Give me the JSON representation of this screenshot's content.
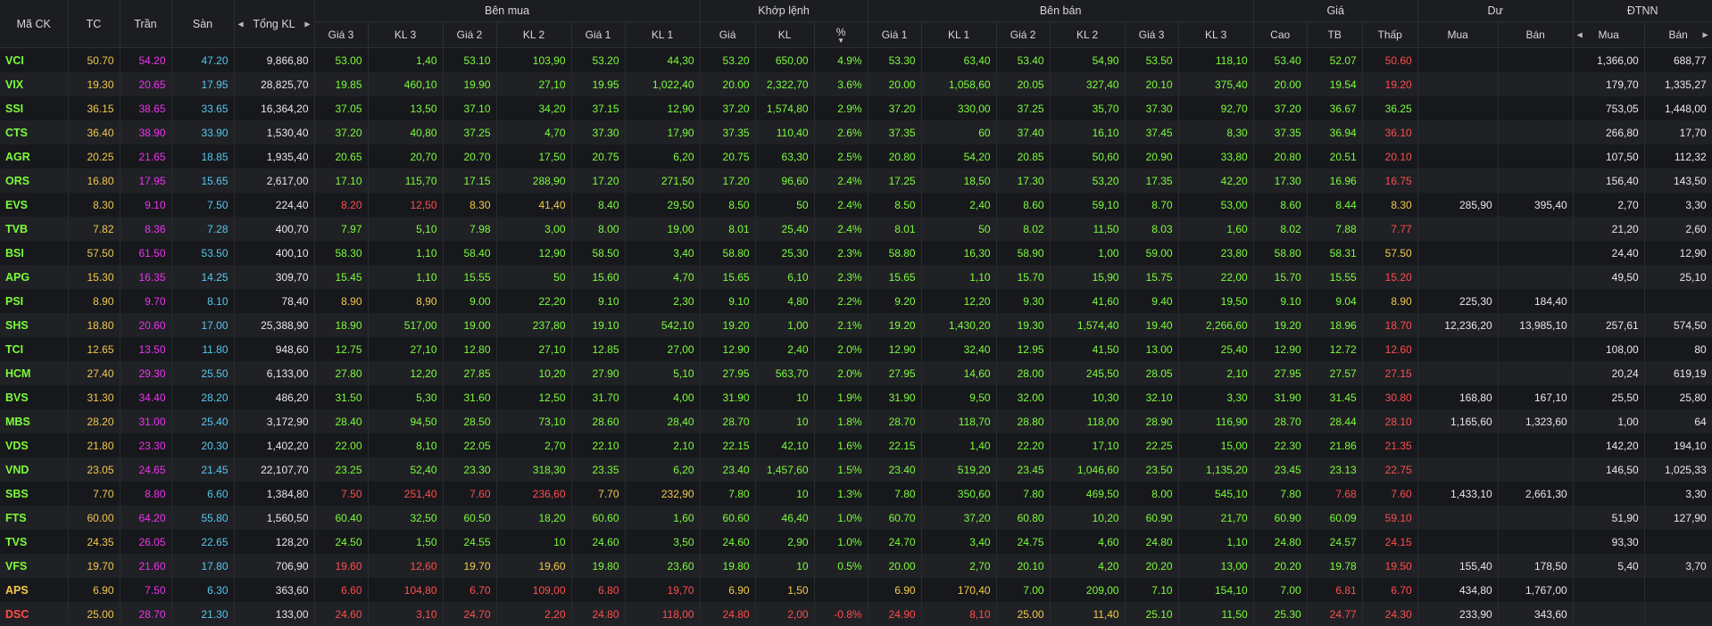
{
  "headers": {
    "symbol": "Mã CK",
    "ref": "TC",
    "ceil": "Trần",
    "floor": "Sàn",
    "total_vol": "Tổng KL",
    "bid_group": "Bên mua",
    "match_group": "Khớp lệnh",
    "ask_group": "Bên bán",
    "price_group": "Giá",
    "rest_group": "Dư",
    "foreign_group": "ĐTNN",
    "bid_price3": "Giá 3",
    "bid_vol3": "KL 3",
    "bid_price2": "Giá 2",
    "bid_vol2": "KL 2",
    "bid_price1": "Giá 1",
    "bid_vol1": "KL 1",
    "match_price": "Giá",
    "match_vol": "KL",
    "match_pct": "%",
    "ask_price1": "Giá 1",
    "ask_vol1": "KL 1",
    "ask_price2": "Giá 2",
    "ask_vol2": "KL 2",
    "ask_price3": "Giá 3",
    "ask_vol3": "KL 3",
    "high": "Cao",
    "avg": "TB",
    "low": "Thấp",
    "rest_buy": "Mua",
    "rest_sell": "Bán",
    "foreign_buy": "Mua",
    "foreign_sell": "Bán"
  },
  "colors": {
    "up": "#7cfc3c",
    "ref": "#f2c94c",
    "down": "#ff4d4d",
    "ceil": "#ee33ee",
    "floor": "#55c8f0",
    "neutral": "#e8e8e8"
  },
  "rows": [
    {
      "sym": "VCI",
      "symc": "g",
      "tc": "50.70",
      "tran": "54.20",
      "san": "47.20",
      "tkl": "9,866,80",
      "bp3": "53.00",
      "bv3": "1,40",
      "bp2": "53.10",
      "bv2": "103,90",
      "bp1": "53.20",
      "bv1": "44,30",
      "bc": "g",
      "mp": "53.20",
      "mv": "650,00",
      "pct": "4.9%",
      "mc": "g",
      "ap1": "53.30",
      "av1": "63,40",
      "ap2": "53.40",
      "av2": "54,90",
      "ap3": "53.50",
      "av3": "118,10",
      "ac": "g",
      "hi": "53.40",
      "hic": "g",
      "avg": "52.07",
      "avgc": "g",
      "lo": "50.60",
      "loc": "r",
      "rb": "",
      "rs": "",
      "fb": "1,366,00",
      "fs": "688,77"
    },
    {
      "sym": "VIX",
      "symc": "g",
      "tc": "19.30",
      "tran": "20.65",
      "san": "17.95",
      "tkl": "28,825,70",
      "bp3": "19.85",
      "bv3": "460,10",
      "bp2": "19.90",
      "bv2": "27,10",
      "bp1": "19.95",
      "bv1": "1,022,40",
      "bc": "g",
      "mp": "20.00",
      "mv": "2,322,70",
      "pct": "3.6%",
      "mc": "g",
      "ap1": "20.00",
      "av1": "1,058,60",
      "ap2": "20.05",
      "av2": "327,40",
      "ap3": "20.10",
      "av3": "375,40",
      "ac": "g",
      "hi": "20.00",
      "hic": "g",
      "avg": "19.54",
      "avgc": "g",
      "lo": "19.20",
      "loc": "r",
      "rb": "",
      "rs": "",
      "fb": "179,70",
      "fs": "1,335,27"
    },
    {
      "sym": "SSI",
      "symc": "g",
      "tc": "36.15",
      "tran": "38.65",
      "san": "33.65",
      "tkl": "16,364,20",
      "bp3": "37.05",
      "bv3": "13,50",
      "bp2": "37.10",
      "bv2": "34,20",
      "bp1": "37.15",
      "bv1": "12,90",
      "bc": "g",
      "mp": "37.20",
      "mv": "1,574,80",
      "pct": "2.9%",
      "mc": "g",
      "ap1": "37.20",
      "av1": "330,00",
      "ap2": "37.25",
      "av2": "35,70",
      "ap3": "37.30",
      "av3": "92,70",
      "ac": "g",
      "hi": "37.20",
      "hic": "g",
      "avg": "36.67",
      "avgc": "g",
      "lo": "36.25",
      "loc": "g",
      "rb": "",
      "rs": "",
      "fb": "753,05",
      "fs": "1,448,00"
    },
    {
      "sym": "CTS",
      "symc": "g",
      "tc": "36.40",
      "tran": "38.90",
      "san": "33.90",
      "tkl": "1,530,40",
      "bp3": "37.20",
      "bv3": "40,80",
      "bp2": "37.25",
      "bv2": "4,70",
      "bp1": "37.30",
      "bv1": "17,90",
      "bc": "g",
      "mp": "37.35",
      "mv": "110,40",
      "pct": "2.6%",
      "mc": "g",
      "ap1": "37.35",
      "av1": "60",
      "ap2": "37.40",
      "av2": "16,10",
      "ap3": "37.45",
      "av3": "8,30",
      "ac": "g",
      "hi": "37.35",
      "hic": "g",
      "avg": "36.94",
      "avgc": "g",
      "lo": "36.10",
      "loc": "r",
      "rb": "",
      "rs": "",
      "fb": "266,80",
      "fs": "17,70"
    },
    {
      "sym": "AGR",
      "symc": "g",
      "tc": "20.25",
      "tran": "21.65",
      "san": "18.85",
      "tkl": "1,935,40",
      "bp3": "20.65",
      "bv3": "20,70",
      "bp2": "20.70",
      "bv2": "17,50",
      "bp1": "20.75",
      "bv1": "6,20",
      "bc": "g",
      "mp": "20.75",
      "mv": "63,30",
      "pct": "2.5%",
      "mc": "g",
      "ap1": "20.80",
      "av1": "54,20",
      "ap2": "20.85",
      "av2": "50,60",
      "ap3": "20.90",
      "av3": "33,80",
      "ac": "g",
      "hi": "20.80",
      "hic": "g",
      "avg": "20.51",
      "avgc": "g",
      "lo": "20.10",
      "loc": "r",
      "rb": "",
      "rs": "",
      "fb": "107,50",
      "fs": "112,32"
    },
    {
      "sym": "ORS",
      "symc": "g",
      "tc": "16.80",
      "tran": "17.95",
      "san": "15.65",
      "tkl": "2,617,00",
      "bp3": "17.10",
      "bv3": "115,70",
      "bp2": "17.15",
      "bv2": "288,90",
      "bp1": "17.20",
      "bv1": "271,50",
      "bc": "g",
      "mp": "17.20",
      "mv": "96,60",
      "pct": "2.4%",
      "mc": "g",
      "ap1": "17.25",
      "av1": "18,50",
      "ap2": "17.30",
      "av2": "53,20",
      "ap3": "17.35",
      "av3": "42,20",
      "ac": "g",
      "hi": "17.30",
      "hic": "g",
      "avg": "16.96",
      "avgc": "g",
      "lo": "16.75",
      "loc": "r",
      "rb": "",
      "rs": "",
      "fb": "156,40",
      "fs": "143,50"
    },
    {
      "sym": "EVS",
      "symc": "g",
      "tc": "8.30",
      "tran": "9.10",
      "san": "7.50",
      "tkl": "224,40",
      "bp3": "8.20",
      "bv3": "12,50",
      "b3c": "r",
      "bp2": "8.30",
      "bv2": "41,40",
      "b2c": "y",
      "bp1": "8.40",
      "bv1": "29,50",
      "bc": "g",
      "mp": "8.50",
      "mv": "50",
      "pct": "2.4%",
      "mc": "g",
      "ap1": "8.50",
      "av1": "2,40",
      "ap2": "8.60",
      "av2": "59,10",
      "ap3": "8.70",
      "av3": "53,00",
      "ac": "g",
      "hi": "8.60",
      "hic": "g",
      "avg": "8.44",
      "avgc": "g",
      "lo": "8.30",
      "loc": "y",
      "rb": "285,90",
      "rs": "395,40",
      "fb": "2,70",
      "fs": "3,30"
    },
    {
      "sym": "TVB",
      "symc": "g",
      "tc": "7.82",
      "tran": "8.36",
      "san": "7.28",
      "tkl": "400,70",
      "bp3": "7.97",
      "bv3": "5,10",
      "bp2": "7.98",
      "bv2": "3,00",
      "bp1": "8.00",
      "bv1": "19,00",
      "bc": "g",
      "mp": "8.01",
      "mv": "25,40",
      "pct": "2.4%",
      "mc": "g",
      "ap1": "8.01",
      "av1": "50",
      "ap2": "8.02",
      "av2": "11,50",
      "ap3": "8.03",
      "av3": "1,60",
      "ac": "g",
      "hi": "8.02",
      "hic": "g",
      "avg": "7.88",
      "avgc": "g",
      "lo": "7.77",
      "loc": "r",
      "rb": "",
      "rs": "",
      "fb": "21,20",
      "fs": "2,60"
    },
    {
      "sym": "BSI",
      "symc": "g",
      "tc": "57.50",
      "tran": "61.50",
      "san": "53.50",
      "tkl": "400,10",
      "bp3": "58.30",
      "bv3": "1,10",
      "bp2": "58.40",
      "bv2": "12,90",
      "bp1": "58.50",
      "bv1": "3,40",
      "bc": "g",
      "mp": "58.80",
      "mv": "25,30",
      "pct": "2.3%",
      "mc": "g",
      "ap1": "58.80",
      "av1": "16,30",
      "ap2": "58.90",
      "av2": "1,00",
      "ap3": "59.00",
      "av3": "23,80",
      "ac": "g",
      "hi": "58.80",
      "hic": "g",
      "avg": "58.31",
      "avgc": "g",
      "lo": "57.50",
      "loc": "y",
      "rb": "",
      "rs": "",
      "fb": "24,40",
      "fs": "12,90"
    },
    {
      "sym": "APG",
      "symc": "g",
      "tc": "15.30",
      "tran": "16.35",
      "san": "14.25",
      "tkl": "309,70",
      "bp3": "15.45",
      "bv3": "1,10",
      "bp2": "15.55",
      "bv2": "50",
      "bp1": "15.60",
      "bv1": "4,70",
      "bc": "g",
      "mp": "15.65",
      "mv": "6,10",
      "pct": "2.3%",
      "mc": "g",
      "ap1": "15.65",
      "av1": "1,10",
      "ap2": "15.70",
      "av2": "15,90",
      "ap3": "15.75",
      "av3": "22,00",
      "ac": "g",
      "hi": "15.70",
      "hic": "g",
      "avg": "15.55",
      "avgc": "g",
      "lo": "15.20",
      "loc": "r",
      "rb": "",
      "rs": "",
      "fb": "49,50",
      "fs": "25,10"
    },
    {
      "sym": "PSI",
      "symc": "g",
      "tc": "8.90",
      "tran": "9.70",
      "san": "8.10",
      "tkl": "78,40",
      "bp3": "8.90",
      "bv3": "8,90",
      "b3c": "y",
      "bp2": "9.00",
      "bv2": "22,20",
      "bp1": "9.10",
      "bv1": "2,30",
      "bc": "g",
      "mp": "9.10",
      "mv": "4,80",
      "pct": "2.2%",
      "mc": "g",
      "ap1": "9.20",
      "av1": "12,20",
      "ap2": "9.30",
      "av2": "41,60",
      "ap3": "9.40",
      "av3": "19,50",
      "ac": "g",
      "hi": "9.10",
      "hic": "g",
      "avg": "9.04",
      "avgc": "g",
      "lo": "8.90",
      "loc": "y",
      "rb": "225,30",
      "rs": "184,40",
      "fb": "",
      "fs": ""
    },
    {
      "sym": "SHS",
      "symc": "g",
      "tc": "18.80",
      "tran": "20.60",
      "san": "17.00",
      "tkl": "25,388,90",
      "bp3": "18.90",
      "bv3": "517,00",
      "bp2": "19.00",
      "bv2": "237,80",
      "bp1": "19.10",
      "bv1": "542,10",
      "bc": "g",
      "mp": "19.20",
      "mv": "1,00",
      "pct": "2.1%",
      "mc": "g",
      "ap1": "19.20",
      "av1": "1,430,20",
      "ap2": "19.30",
      "av2": "1,574,40",
      "ap3": "19.40",
      "av3": "2,266,60",
      "ac": "g",
      "hi": "19.20",
      "hic": "g",
      "avg": "18.96",
      "avgc": "g",
      "lo": "18.70",
      "loc": "r",
      "rb": "12,236,20",
      "rs": "13,985,10",
      "fb": "257,61",
      "fs": "574,50"
    },
    {
      "sym": "TCI",
      "symc": "g",
      "tc": "12.65",
      "tran": "13.50",
      "san": "11.80",
      "tkl": "948,60",
      "bp3": "12.75",
      "bv3": "27,10",
      "bp2": "12.80",
      "bv2": "27,10",
      "bp1": "12.85",
      "bv1": "27,00",
      "bc": "g",
      "mp": "12.90",
      "mv": "2,40",
      "pct": "2.0%",
      "mc": "g",
      "ap1": "12.90",
      "av1": "32,40",
      "ap2": "12.95",
      "av2": "41,50",
      "ap3": "13.00",
      "av3": "25,40",
      "ac": "g",
      "hi": "12.90",
      "hic": "g",
      "avg": "12.72",
      "avgc": "g",
      "lo": "12.60",
      "loc": "r",
      "rb": "",
      "rs": "",
      "fb": "108,00",
      "fs": "80"
    },
    {
      "sym": "HCM",
      "symc": "g",
      "tc": "27.40",
      "tran": "29.30",
      "san": "25.50",
      "tkl": "6,133,00",
      "bp3": "27.80",
      "bv3": "12,20",
      "bp2": "27.85",
      "bv2": "10,20",
      "bp1": "27.90",
      "bv1": "5,10",
      "bc": "g",
      "mp": "27.95",
      "mv": "563,70",
      "pct": "2.0%",
      "mc": "g",
      "ap1": "27.95",
      "av1": "14,60",
      "ap2": "28.00",
      "av2": "245,50",
      "ap3": "28.05",
      "av3": "2,10",
      "ac": "g",
      "hi": "27.95",
      "hic": "g",
      "avg": "27.57",
      "avgc": "g",
      "lo": "27.15",
      "loc": "r",
      "rb": "",
      "rs": "",
      "fb": "20,24",
      "fs": "619,19"
    },
    {
      "sym": "BVS",
      "symc": "g",
      "tc": "31.30",
      "tran": "34.40",
      "san": "28.20",
      "tkl": "486,20",
      "bp3": "31.50",
      "bv3": "5,30",
      "bp2": "31.60",
      "bv2": "12,50",
      "bp1": "31.70",
      "bv1": "4,00",
      "bc": "g",
      "mp": "31.90",
      "mv": "10",
      "pct": "1.9%",
      "mc": "g",
      "ap1": "31.90",
      "av1": "9,50",
      "ap2": "32.00",
      "av2": "10,30",
      "ap3": "32.10",
      "av3": "3,30",
      "ac": "g",
      "hi": "31.90",
      "hic": "g",
      "avg": "31.45",
      "avgc": "g",
      "lo": "30.80",
      "loc": "r",
      "rb": "168,80",
      "rs": "167,10",
      "fb": "25,50",
      "fs": "25,80"
    },
    {
      "sym": "MBS",
      "symc": "g",
      "tc": "28.20",
      "tran": "31.00",
      "san": "25.40",
      "tkl": "3,172,90",
      "bp3": "28.40",
      "bv3": "94,50",
      "bp2": "28.50",
      "bv2": "73,10",
      "bp1": "28.60",
      "bv1": "28,40",
      "bc": "g",
      "mp": "28.70",
      "mv": "10",
      "pct": "1.8%",
      "mc": "g",
      "ap1": "28.70",
      "av1": "118,70",
      "ap2": "28.80",
      "av2": "118,00",
      "ap3": "28.90",
      "av3": "116,90",
      "ac": "g",
      "hi": "28.70",
      "hic": "g",
      "avg": "28.44",
      "avgc": "g",
      "lo": "28.10",
      "loc": "r",
      "rb": "1,165,60",
      "rs": "1,323,60",
      "fb": "1,00",
      "fs": "64"
    },
    {
      "sym": "VDS",
      "symc": "g",
      "tc": "21.80",
      "tran": "23.30",
      "san": "20.30",
      "tkl": "1,402,20",
      "bp3": "22.00",
      "bv3": "8,10",
      "bp2": "22.05",
      "bv2": "2,70",
      "bp1": "22.10",
      "bv1": "2,10",
      "bc": "g",
      "mp": "22.15",
      "mv": "42,10",
      "pct": "1.6%",
      "mc": "g",
      "ap1": "22.15",
      "av1": "1,40",
      "ap2": "22.20",
      "av2": "17,10",
      "ap3": "22.25",
      "av3": "15,00",
      "ac": "g",
      "hi": "22.30",
      "hic": "g",
      "avg": "21.86",
      "avgc": "g",
      "lo": "21.35",
      "loc": "r",
      "rb": "",
      "rs": "",
      "fb": "142,20",
      "fs": "194,10"
    },
    {
      "sym": "VND",
      "symc": "g",
      "tc": "23.05",
      "tran": "24.65",
      "san": "21.45",
      "tkl": "22,107,70",
      "bp3": "23.25",
      "bv3": "52,40",
      "bp2": "23.30",
      "bv2": "318,30",
      "bp1": "23.35",
      "bv1": "6,20",
      "bc": "g",
      "mp": "23.40",
      "mv": "1,457,60",
      "pct": "1.5%",
      "mc": "g",
      "ap1": "23.40",
      "av1": "519,20",
      "ap2": "23.45",
      "av2": "1,046,60",
      "ap3": "23.50",
      "av3": "1,135,20",
      "ac": "g",
      "hi": "23.45",
      "hic": "g",
      "avg": "23.13",
      "avgc": "g",
      "lo": "22.75",
      "loc": "r",
      "rb": "",
      "rs": "",
      "fb": "146,50",
      "fs": "1,025,33"
    },
    {
      "sym": "SBS",
      "symc": "g",
      "tc": "7.70",
      "tran": "8.80",
      "san": "6.60",
      "tkl": "1,384,80",
      "bp3": "7.50",
      "bv3": "251,40",
      "b3c": "r",
      "bp2": "7.60",
      "bv2": "236,60",
      "b2c": "r",
      "bp1": "7.70",
      "bv1": "232,90",
      "bc": "y",
      "mp": "7.80",
      "mv": "10",
      "pct": "1.3%",
      "mc": "g",
      "ap1": "7.80",
      "av1": "350,60",
      "ap2": "7.80",
      "av2": "469,50",
      "ap3": "8.00",
      "av3": "545,10",
      "ac": "g",
      "hi": "7.80",
      "hic": "g",
      "avg": "7.68",
      "avgc": "r",
      "lo": "7.60",
      "loc": "r",
      "rb": "1,433,10",
      "rs": "2,661,30",
      "fb": "",
      "fs": "3,30"
    },
    {
      "sym": "FTS",
      "symc": "g",
      "tc": "60.00",
      "tran": "64.20",
      "san": "55.80",
      "tkl": "1,560,50",
      "bp3": "60.40",
      "bv3": "32,50",
      "bp2": "60.50",
      "bv2": "18,20",
      "bp1": "60.60",
      "bv1": "1,60",
      "bc": "g",
      "mp": "60.60",
      "mv": "46,40",
      "pct": "1.0%",
      "mc": "g",
      "ap1": "60.70",
      "av1": "37,20",
      "ap2": "60.80",
      "av2": "10,20",
      "ap3": "60.90",
      "av3": "21,70",
      "ac": "g",
      "hi": "60.90",
      "hic": "g",
      "avg": "60.09",
      "avgc": "g",
      "lo": "59.10",
      "loc": "r",
      "rb": "",
      "rs": "",
      "fb": "51,90",
      "fs": "127,90"
    },
    {
      "sym": "TVS",
      "symc": "g",
      "tc": "24.35",
      "tran": "26.05",
      "san": "22.65",
      "tkl": "128,20",
      "bp3": "24.50",
      "bv3": "1,50",
      "bp2": "24.55",
      "bv2": "10",
      "bp1": "24.60",
      "bv1": "3,50",
      "bc": "g",
      "mp": "24.60",
      "mv": "2,90",
      "pct": "1.0%",
      "mc": "g",
      "ap1": "24.70",
      "av1": "3,40",
      "ap2": "24.75",
      "av2": "4,60",
      "ap3": "24.80",
      "av3": "1,10",
      "ac": "g",
      "hi": "24.80",
      "hic": "g",
      "avg": "24.57",
      "avgc": "g",
      "lo": "24.15",
      "loc": "r",
      "rb": "",
      "rs": "",
      "fb": "93,30",
      "fs": ""
    },
    {
      "sym": "VFS",
      "symc": "g",
      "tc": "19.70",
      "tran": "21.60",
      "san": "17.80",
      "tkl": "706,90",
      "bp3": "19.60",
      "bv3": "12,60",
      "b3c": "r",
      "bp2": "19.70",
      "bv2": "19,60",
      "b2c": "y",
      "bp1": "19.80",
      "bv1": "23,60",
      "bc": "g",
      "mp": "19.80",
      "mv": "10",
      "pct": "0.5%",
      "mc": "g",
      "ap1": "20.00",
      "av1": "2,70",
      "ap2": "20.10",
      "av2": "4,20",
      "ap3": "20.20",
      "av3": "13,00",
      "ac": "g",
      "hi": "20.20",
      "hic": "g",
      "avg": "19.78",
      "avgc": "g",
      "lo": "19.50",
      "loc": "r",
      "rb": "155,40",
      "rs": "178,50",
      "fb": "5,40",
      "fs": "3,70"
    },
    {
      "sym": "APS",
      "symc": "y",
      "tc": "6.90",
      "tran": "7.50",
      "san": "6.30",
      "tkl": "363,60",
      "bp3": "6.60",
      "bv3": "104,80",
      "b3c": "r",
      "bp2": "6.70",
      "bv2": "109,00",
      "b2c": "r",
      "bp1": "6.80",
      "bv1": "19,70",
      "bc": "r",
      "mp": "6.90",
      "mv": "1,50",
      "pct": "",
      "mc": "y",
      "ap1": "6.90",
      "av1": "170,40",
      "a1c": "y",
      "ap2": "7.00",
      "av2": "209,00",
      "ap3": "7.10",
      "av3": "154,10",
      "ac": "g",
      "hi": "7.00",
      "hic": "g",
      "avg": "6.81",
      "avgc": "r",
      "lo": "6.70",
      "loc": "r",
      "rb": "434,80",
      "rs": "1,767,00",
      "fb": "",
      "fs": ""
    },
    {
      "sym": "DSC",
      "symc": "r",
      "tc": "25.00",
      "tran": "28.70",
      "san": "21.30",
      "tkl": "133,00",
      "bp3": "24.60",
      "bv3": "3,10",
      "b3c": "r",
      "bp2": "24.70",
      "bv2": "2,20",
      "b2c": "r",
      "bp1": "24.80",
      "bv1": "118,00",
      "bc": "r",
      "mp": "24.80",
      "mv": "2,00",
      "pct": "-0.8%",
      "mc": "r",
      "ap1": "24.90",
      "av1": "8,10",
      "a1c": "r",
      "ap2": "25.00",
      "av2": "11,40",
      "a2c": "y",
      "ap3": "25.10",
      "av3": "11,50",
      "ac": "g",
      "hi": "25.30",
      "hic": "g",
      "avg": "24.77",
      "avgc": "r",
      "lo": "24.30",
      "loc": "r",
      "rb": "233,90",
      "rs": "343,60",
      "fb": "",
      "fs": ""
    }
  ]
}
